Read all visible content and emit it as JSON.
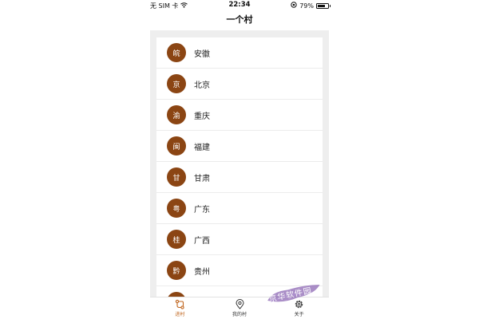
{
  "status_bar": {
    "carrier": "无 SIM 卡",
    "time": "22:34",
    "battery": "79%",
    "battery_level": 0.79
  },
  "nav": {
    "title": "一个村"
  },
  "provinces": [
    {
      "abbr": "皖",
      "name": "安徽"
    },
    {
      "abbr": "京",
      "name": "北京"
    },
    {
      "abbr": "渝",
      "name": "重庆"
    },
    {
      "abbr": "闽",
      "name": "福建"
    },
    {
      "abbr": "甘",
      "name": "甘肃"
    },
    {
      "abbr": "粤",
      "name": "广东"
    },
    {
      "abbr": "桂",
      "name": "广西"
    },
    {
      "abbr": "黔",
      "name": "贵州"
    },
    {
      "abbr": "",
      "name": ""
    }
  ],
  "tabs": [
    {
      "label": "进村",
      "icon": "route-icon",
      "active": true
    },
    {
      "label": "我的村",
      "icon": "location-pin-icon",
      "active": false
    },
    {
      "label": "关于",
      "icon": "gear-icon",
      "active": false
    }
  ],
  "colors": {
    "badge": "#8b4513",
    "active_tab": "#c0651d",
    "background": "#eeeeee"
  },
  "watermark": {
    "text": "京华软件园"
  }
}
